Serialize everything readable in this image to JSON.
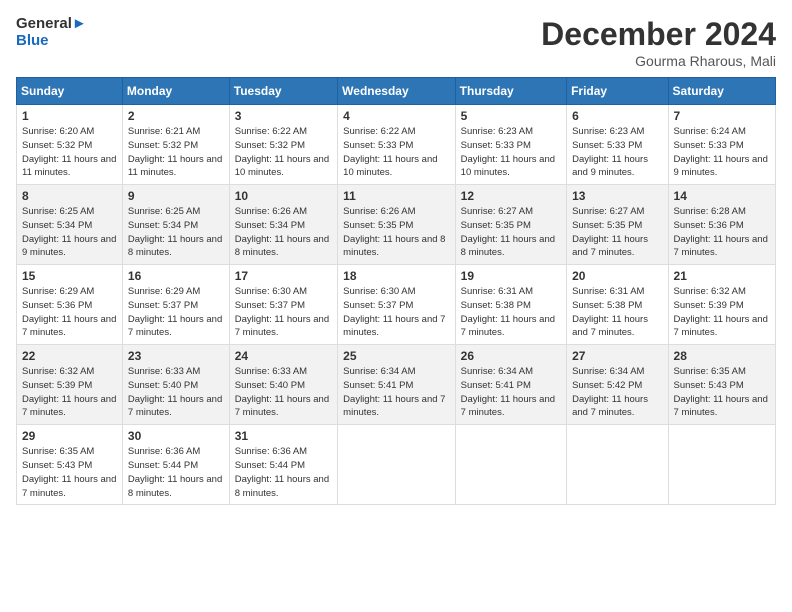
{
  "logo": {
    "line1": "General",
    "line2": "Blue"
  },
  "title": "December 2024",
  "subtitle": "Gourma Rharous, Mali",
  "headers": [
    "Sunday",
    "Monday",
    "Tuesday",
    "Wednesday",
    "Thursday",
    "Friday",
    "Saturday"
  ],
  "weeks": [
    [
      {
        "day": "1",
        "sunrise": "6:20 AM",
        "sunset": "5:32 PM",
        "daylight": "11 hours and 11 minutes."
      },
      {
        "day": "2",
        "sunrise": "6:21 AM",
        "sunset": "5:32 PM",
        "daylight": "11 hours and 11 minutes."
      },
      {
        "day": "3",
        "sunrise": "6:22 AM",
        "sunset": "5:32 PM",
        "daylight": "11 hours and 10 minutes."
      },
      {
        "day": "4",
        "sunrise": "6:22 AM",
        "sunset": "5:33 PM",
        "daylight": "11 hours and 10 minutes."
      },
      {
        "day": "5",
        "sunrise": "6:23 AM",
        "sunset": "5:33 PM",
        "daylight": "11 hours and 10 minutes."
      },
      {
        "day": "6",
        "sunrise": "6:23 AM",
        "sunset": "5:33 PM",
        "daylight": "11 hours and 9 minutes."
      },
      {
        "day": "7",
        "sunrise": "6:24 AM",
        "sunset": "5:33 PM",
        "daylight": "11 hours and 9 minutes."
      }
    ],
    [
      {
        "day": "8",
        "sunrise": "6:25 AM",
        "sunset": "5:34 PM",
        "daylight": "11 hours and 9 minutes."
      },
      {
        "day": "9",
        "sunrise": "6:25 AM",
        "sunset": "5:34 PM",
        "daylight": "11 hours and 8 minutes."
      },
      {
        "day": "10",
        "sunrise": "6:26 AM",
        "sunset": "5:34 PM",
        "daylight": "11 hours and 8 minutes."
      },
      {
        "day": "11",
        "sunrise": "6:26 AM",
        "sunset": "5:35 PM",
        "daylight": "11 hours and 8 minutes."
      },
      {
        "day": "12",
        "sunrise": "6:27 AM",
        "sunset": "5:35 PM",
        "daylight": "11 hours and 8 minutes."
      },
      {
        "day": "13",
        "sunrise": "6:27 AM",
        "sunset": "5:35 PM",
        "daylight": "11 hours and 7 minutes."
      },
      {
        "day": "14",
        "sunrise": "6:28 AM",
        "sunset": "5:36 PM",
        "daylight": "11 hours and 7 minutes."
      }
    ],
    [
      {
        "day": "15",
        "sunrise": "6:29 AM",
        "sunset": "5:36 PM",
        "daylight": "11 hours and 7 minutes."
      },
      {
        "day": "16",
        "sunrise": "6:29 AM",
        "sunset": "5:37 PM",
        "daylight": "11 hours and 7 minutes."
      },
      {
        "day": "17",
        "sunrise": "6:30 AM",
        "sunset": "5:37 PM",
        "daylight": "11 hours and 7 minutes."
      },
      {
        "day": "18",
        "sunrise": "6:30 AM",
        "sunset": "5:37 PM",
        "daylight": "11 hours and 7 minutes."
      },
      {
        "day": "19",
        "sunrise": "6:31 AM",
        "sunset": "5:38 PM",
        "daylight": "11 hours and 7 minutes."
      },
      {
        "day": "20",
        "sunrise": "6:31 AM",
        "sunset": "5:38 PM",
        "daylight": "11 hours and 7 minutes."
      },
      {
        "day": "21",
        "sunrise": "6:32 AM",
        "sunset": "5:39 PM",
        "daylight": "11 hours and 7 minutes."
      }
    ],
    [
      {
        "day": "22",
        "sunrise": "6:32 AM",
        "sunset": "5:39 PM",
        "daylight": "11 hours and 7 minutes."
      },
      {
        "day": "23",
        "sunrise": "6:33 AM",
        "sunset": "5:40 PM",
        "daylight": "11 hours and 7 minutes."
      },
      {
        "day": "24",
        "sunrise": "6:33 AM",
        "sunset": "5:40 PM",
        "daylight": "11 hours and 7 minutes."
      },
      {
        "day": "25",
        "sunrise": "6:34 AM",
        "sunset": "5:41 PM",
        "daylight": "11 hours and 7 minutes."
      },
      {
        "day": "26",
        "sunrise": "6:34 AM",
        "sunset": "5:41 PM",
        "daylight": "11 hours and 7 minutes."
      },
      {
        "day": "27",
        "sunrise": "6:34 AM",
        "sunset": "5:42 PM",
        "daylight": "11 hours and 7 minutes."
      },
      {
        "day": "28",
        "sunrise": "6:35 AM",
        "sunset": "5:43 PM",
        "daylight": "11 hours and 7 minutes."
      }
    ],
    [
      {
        "day": "29",
        "sunrise": "6:35 AM",
        "sunset": "5:43 PM",
        "daylight": "11 hours and 7 minutes."
      },
      {
        "day": "30",
        "sunrise": "6:36 AM",
        "sunset": "5:44 PM",
        "daylight": "11 hours and 8 minutes."
      },
      {
        "day": "31",
        "sunrise": "6:36 AM",
        "sunset": "5:44 PM",
        "daylight": "11 hours and 8 minutes."
      },
      null,
      null,
      null,
      null
    ]
  ]
}
